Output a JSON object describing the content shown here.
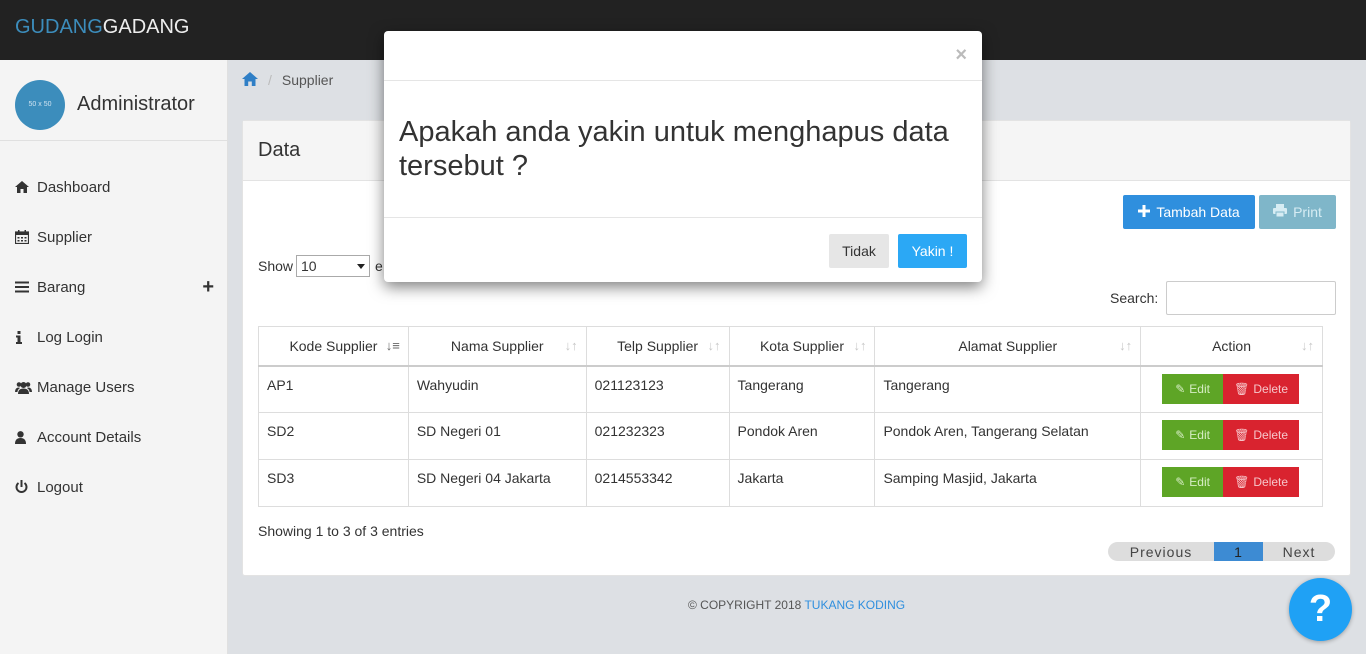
{
  "brand": {
    "part1": "GUDANG",
    "part2": "GADANG"
  },
  "user": {
    "avatar_text": "50 x 50",
    "name": "Administrator"
  },
  "sidebar": {
    "items": [
      {
        "label": "Dashboard",
        "icon": "home-icon"
      },
      {
        "label": "Supplier",
        "icon": "calendar-icon"
      },
      {
        "label": "Barang",
        "icon": "list-icon"
      },
      {
        "label": "Log Login",
        "icon": "info-icon"
      },
      {
        "label": "Manage Users",
        "icon": "users-icon"
      },
      {
        "label": "Account Details",
        "icon": "user-icon"
      },
      {
        "label": "Logout",
        "icon": "power-icon"
      }
    ]
  },
  "breadcrumb": {
    "current": "Supplier"
  },
  "panel": {
    "title": "Data"
  },
  "toolbar": {
    "add_label": "Tambah Data",
    "print_label": "Print"
  },
  "length": {
    "show_label": "Show",
    "value": "10",
    "after_label": "e"
  },
  "search": {
    "label": "Search:",
    "value": ""
  },
  "table": {
    "headers": [
      "Kode Supplier",
      "Nama Supplier",
      "Telp Supplier",
      "Kota Supplier",
      "Alamat Supplier",
      "Action"
    ],
    "rows": [
      {
        "kode": "AP1",
        "nama": "Wahyudin",
        "telp": "021123123",
        "kota": "Tangerang",
        "alamat": "Tangerang"
      },
      {
        "kode": "SD2",
        "nama": "SD Negeri 01",
        "telp": "021232323",
        "kota": "Pondok Aren",
        "alamat": "Pondok Aren, Tangerang Selatan"
      },
      {
        "kode": "SD3",
        "nama": "SD Negeri 04 Jakarta",
        "telp": "0214553342",
        "kota": "Jakarta",
        "alamat": "Samping Masjid, Jakarta"
      }
    ],
    "edit_label": "Edit",
    "delete_label": "Delete"
  },
  "info": {
    "showing": "Showing 1 to 3 of 3 entries"
  },
  "pagination": {
    "previous": "Previous",
    "page": "1",
    "next": "Next"
  },
  "footer": {
    "copyright": "© COPYRIGHT 2018",
    "link": "TUKANG KODING"
  },
  "help": {
    "label": "?"
  },
  "modal": {
    "close": "×",
    "message": "Apakah anda yakin untuk menghapus data tersebut ?",
    "cancel": "Tidak",
    "confirm": "Yakin !"
  },
  "colors": {
    "brand_blue": "#3c8dbc",
    "primary": "#2f8fde",
    "success": "#5ea526",
    "danger": "#d9232f",
    "confirm": "#2ba8f5"
  }
}
